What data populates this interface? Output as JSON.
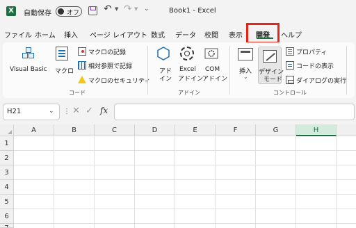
{
  "titlebar": {
    "app_logo": "X",
    "autosave_label": "自動保存",
    "autosave_state": "オフ",
    "document_title": "Book1 - Excel",
    "icons": [
      "excel-logo-icon",
      "save-icon",
      "undo-icon",
      "redo-icon",
      "more-icon"
    ]
  },
  "tabs": [
    "ファイル",
    "ホーム",
    "挿入",
    "ページ レイアウト",
    "数式",
    "データ",
    "校閲",
    "表示",
    "開発",
    "ヘルプ"
  ],
  "active_tab": "開発",
  "ribbon": {
    "code": {
      "label": "コード",
      "visual_basic": "Visual Basic",
      "macro": "マクロ",
      "record_macro": "マクロの記録",
      "relative_ref": "相対参照で記録",
      "macro_security": "マクロのセキュリティ"
    },
    "addins": {
      "label": "アドイン",
      "addin": [
        "アド",
        "イン"
      ],
      "excel_addin": [
        "Excel",
        "アドイン"
      ],
      "com_addin": [
        "COM",
        "アドイン"
      ]
    },
    "controls": {
      "label": "コントロール",
      "insert": "挿入",
      "design_mode": [
        "デザイン",
        "モード"
      ],
      "properties": "プロパティ",
      "view_code": "コードの表示",
      "run_dialog": "ダイアログの実行"
    }
  },
  "formula_bar": {
    "name_box": "H21",
    "fx": "fx",
    "formula_value": ""
  },
  "grid": {
    "columns": [
      "A",
      "B",
      "C",
      "D",
      "E",
      "F",
      "G",
      "H"
    ],
    "selected_column": "H",
    "rows": [
      "1",
      "2",
      "3",
      "4",
      "5",
      "6",
      "7"
    ]
  },
  "colors": {
    "excel_green": "#1d6f42",
    "highlight_red": "#e8231a",
    "save_purple": "#7a3db8"
  }
}
